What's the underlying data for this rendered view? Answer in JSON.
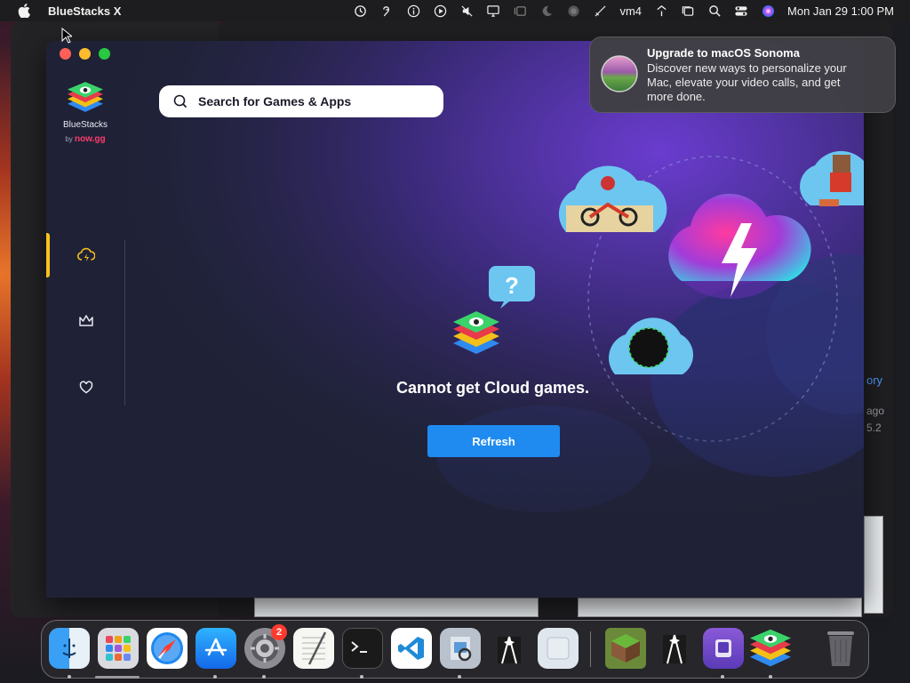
{
  "menubar": {
    "app_name": "BlueStacks X",
    "user": "vm4",
    "datetime": "Mon Jan 29  1:00 PM"
  },
  "notification": {
    "title": "Upgrade to macOS Sonoma",
    "body": "Discover new ways to personalize your Mac, elevate your video calls, and get more done."
  },
  "bluestacks": {
    "brand_name": "BlueStacks",
    "brand_by": "by",
    "brand_nowgg": "now.gg",
    "search_placeholder": "Search for Games & Apps",
    "nav": [
      {
        "name": "cloud-games",
        "icon": "cloud-lightning-icon",
        "active": true
      },
      {
        "name": "my-games",
        "icon": "crown-icon",
        "active": false
      },
      {
        "name": "favorites",
        "icon": "heart-icon",
        "active": false
      }
    ],
    "error_text": "Cannot get Cloud games.",
    "refresh_label": "Refresh"
  },
  "background_window": {
    "partial_link": "ory",
    "partial_meta_1": "ago",
    "partial_meta_2": "5.2"
  },
  "dock": {
    "apps": [
      "Finder",
      "Launchpad",
      "Safari",
      "App Store",
      "System Settings",
      "TextEdit",
      "Terminal",
      "Visual Studio Code",
      "Preview",
      "Bartender",
      "Blank",
      "Minecraft",
      "Bartender 5",
      "Apple Configurator",
      "BlueStacks X",
      "Trash"
    ],
    "settings_badge": "2"
  },
  "colors": {
    "accent": "#1f8bf0",
    "active_indicator": "#f7c21d",
    "window_bg": "#1f2236"
  }
}
